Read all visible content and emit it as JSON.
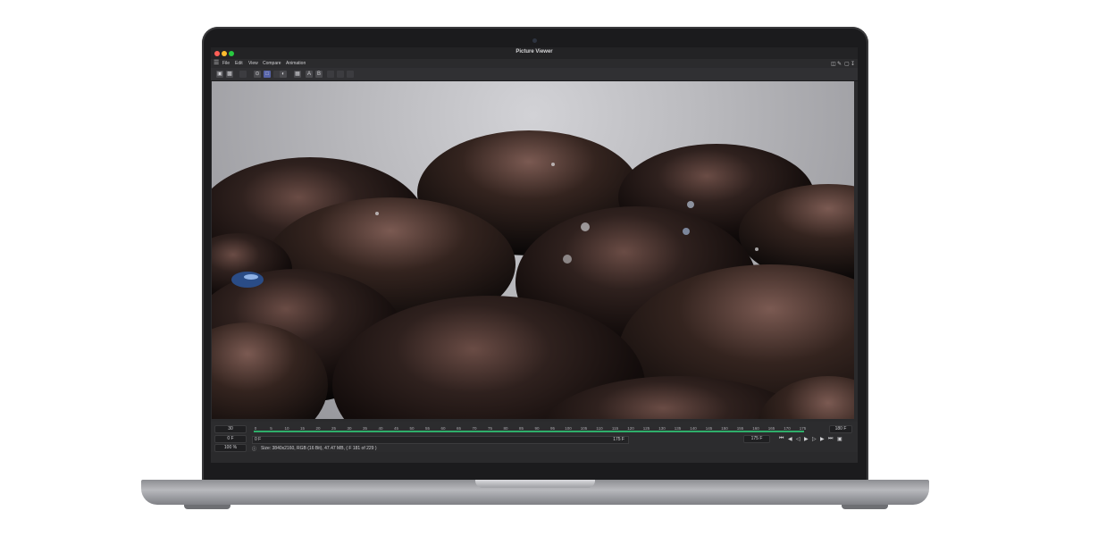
{
  "window": {
    "title": "Picture Viewer",
    "traffic_colors": [
      "#ff5f57",
      "#febc2e",
      "#28c840"
    ]
  },
  "menu": {
    "icon": "hamburger-icon",
    "items": [
      "File",
      "Edit",
      "View",
      "Compare",
      "Animation"
    ]
  },
  "toolbar": {
    "text_buttons": [
      "A",
      "B"
    ],
    "icons": [
      "folder-icon",
      "save-icon",
      "stop-icon",
      "region-icon",
      "crop-icon",
      "filter-icon",
      "contrast-icon",
      "channel-icon",
      "compare-a-icon",
      "compare-b-icon",
      "swap-icon",
      "stereo-icon"
    ],
    "right_icons": [
      "layout-icon",
      "edit-icon",
      "close-panel-icon",
      "download-icon"
    ]
  },
  "timeline": {
    "fps": "30",
    "start_frame": "0 F",
    "zoom": "100 %",
    "end_frame": "180 F",
    "ruler_ticks": [
      "0",
      "5",
      "10",
      "15",
      "20",
      "25",
      "30",
      "35",
      "40",
      "45",
      "50",
      "55",
      "60",
      "65",
      "70",
      "75",
      "80",
      "85",
      "90",
      "95",
      "100",
      "105",
      "110",
      "115",
      "120",
      "125",
      "130",
      "135",
      "140",
      "145",
      "150",
      "155",
      "160",
      "165",
      "170",
      "175"
    ],
    "range_start": "0 F",
    "range_end": "175 F",
    "current_frame": "175 F",
    "progress": 0.97,
    "info": "Size: 3840x2160, RGB (16 Bit), 47.47 MB, ( F 181 of 229 )",
    "playback_icons": [
      "first-frame-icon",
      "prev-key-icon",
      "prev-frame-icon",
      "play-icon",
      "next-frame-icon",
      "next-key-icon",
      "last-frame-icon",
      "record-icon"
    ]
  },
  "colors": {
    "accent": "#5663a8",
    "progress": "#2fae6a",
    "window_bg": "#2a2a2c"
  }
}
